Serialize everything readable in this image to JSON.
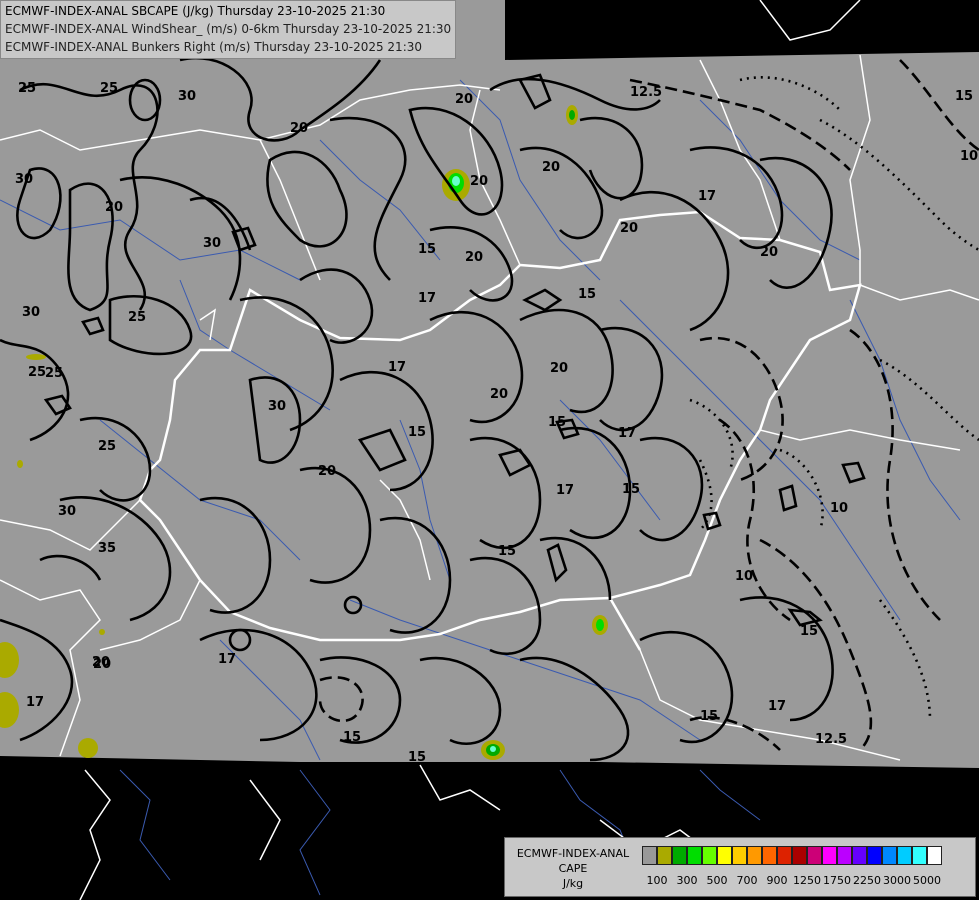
{
  "header": {
    "line1": "ECMWF-INDEX-ANAL SBCAPE (J/kg) Thursday 23-10-2025 21:30",
    "line2": "ECMWF-INDEX-ANAL WindShear_ (m/s) 0-6km Thursday 23-10-2025 21:30",
    "line3": "ECMWF-INDEX-ANAL Bunkers Right (m/s) Thursday 23-10-2025 21:30"
  },
  "legend": {
    "line1": "ECMWF-INDEX-ANAL",
    "line2": "CAPE",
    "line3": "J/kg",
    "colors": [
      "#999999",
      "#aaaa00",
      "#00aa00",
      "#00dd00",
      "#66ff00",
      "#ffff00",
      "#ffcc00",
      "#ff9900",
      "#ff6600",
      "#dd2200",
      "#aa0000",
      "#cc0077",
      "#ff00ff",
      "#bb00ff",
      "#6600ff",
      "#0000ff",
      "#0088ff",
      "#00ccff",
      "#33ffff",
      "#ffffff"
    ],
    "ticks": [
      "100",
      "300",
      "500",
      "700",
      "900",
      "1250",
      "1750",
      "2250",
      "3000",
      "5000"
    ]
  },
  "contour_labels": [
    "25",
    "25",
    "30",
    "20",
    "20",
    "25",
    "30",
    "20",
    "30",
    "25",
    "30",
    "25",
    "30",
    "25",
    "35",
    "20",
    "17",
    "15",
    "20",
    "17",
    "20",
    "15",
    "20",
    "20",
    "20",
    "30",
    "20",
    "17",
    "15",
    "20",
    "15",
    "17",
    "15",
    "15",
    "17",
    "15",
    "17",
    "20",
    "17",
    "15",
    "12.5",
    "15",
    "10",
    "10",
    "10",
    "15",
    "12.5",
    "17",
    "20",
    "15"
  ]
}
